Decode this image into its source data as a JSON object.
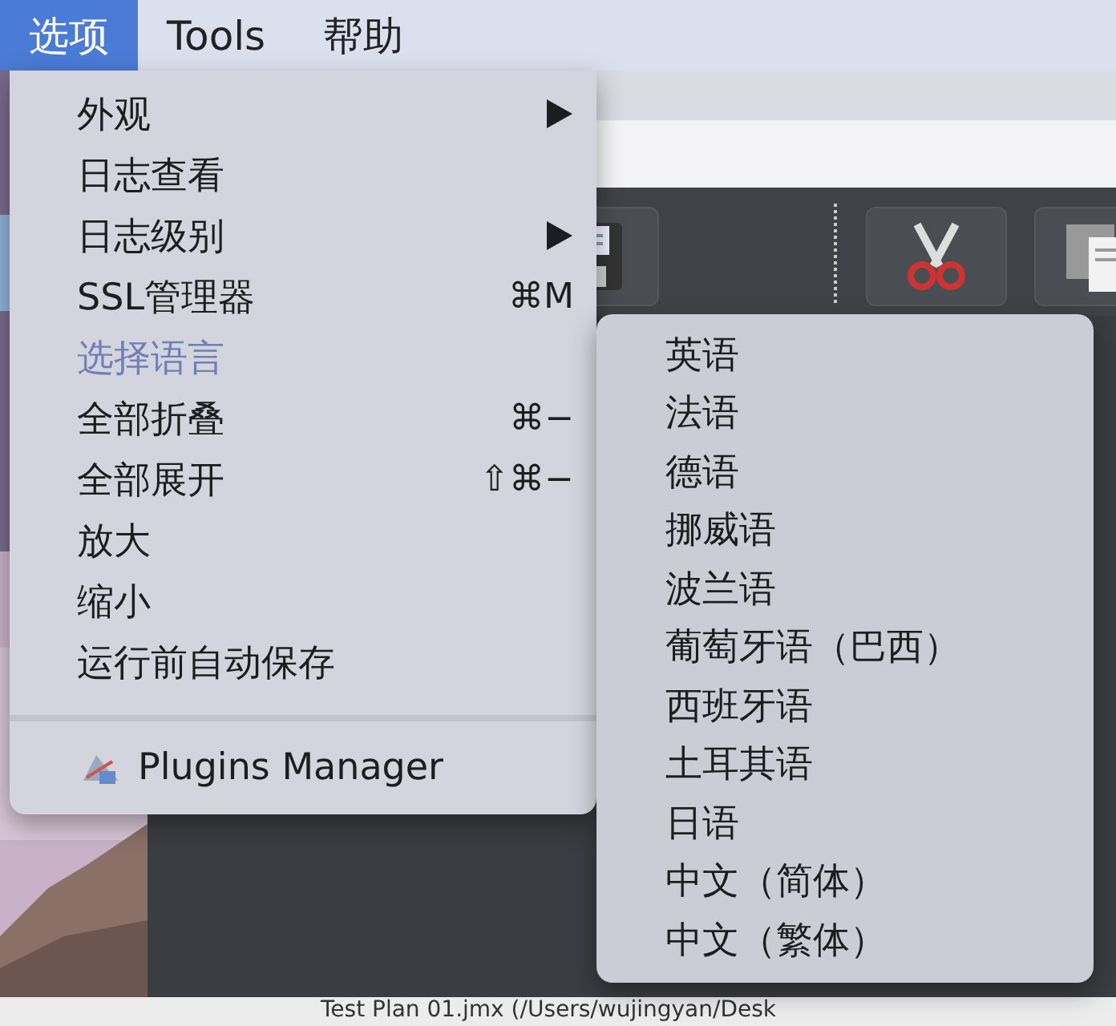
{
  "menu_bar": [
    {
      "label": "选项",
      "selected": true
    },
    {
      "label": "Tools",
      "selected": false
    },
    {
      "label": "帮助",
      "selected": false
    }
  ],
  "menu": {
    "items": [
      {
        "kind": "item",
        "label": "外观",
        "submenu": true
      },
      {
        "kind": "item",
        "label": "日志查看"
      },
      {
        "kind": "item",
        "label": "日志级别",
        "submenu": true
      },
      {
        "kind": "item",
        "label": "SSL管理器",
        "shortcut": "⌘M"
      },
      {
        "kind": "faded",
        "label": "选择语言"
      },
      {
        "kind": "item",
        "label": "全部折叠",
        "shortcut": "⌘−"
      },
      {
        "kind": "item",
        "label": "全部展开",
        "shortcut": "⇧⌘−"
      },
      {
        "kind": "item",
        "label": "放大"
      },
      {
        "kind": "item",
        "label": "缩小"
      },
      {
        "kind": "item",
        "label": "运行前自动保存"
      },
      {
        "kind": "separator"
      },
      {
        "kind": "plugin",
        "label": "Plugins Manager"
      }
    ]
  },
  "submenu": {
    "items": [
      {
        "label": "英语"
      },
      {
        "label": "法语"
      },
      {
        "label": "德语"
      },
      {
        "label": "挪威语"
      },
      {
        "label": "波兰语"
      },
      {
        "label": "葡萄牙语（巴西）"
      },
      {
        "label": "西班牙语"
      },
      {
        "label": "土耳其语"
      },
      {
        "label": "日语"
      },
      {
        "label": "中文（简体）"
      },
      {
        "label": "中文（繁体）"
      }
    ]
  },
  "status_bar": {
    "title": "Test Plan 01.jmx (/Users/wujingyan/Desk"
  }
}
